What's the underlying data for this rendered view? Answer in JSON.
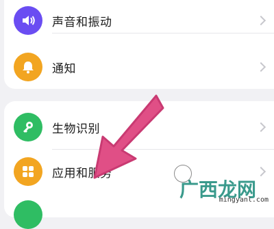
{
  "settings": {
    "items": [
      {
        "label": "声音和振动",
        "icon": "speaker-icon",
        "color": "#6a4df2"
      },
      {
        "label": "通知",
        "icon": "bell-icon",
        "color": "#f2a521"
      },
      {
        "label": "生物识别",
        "icon": "key-icon",
        "color": "#2fbd63"
      },
      {
        "label": "应用和服务",
        "icon": "apps-grid-icon",
        "color": "#f2a521"
      }
    ]
  },
  "watermark": {
    "text": "广西龙网",
    "url": "mingyanl.com"
  }
}
